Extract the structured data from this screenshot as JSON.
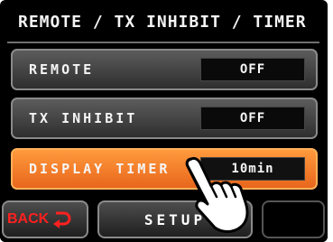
{
  "title": "REMOTE / TX INHIBIT / TIMER",
  "rows": [
    {
      "label": "REMOTE",
      "value": "OFF"
    },
    {
      "label": "TX INHIBIT",
      "value": "OFF"
    },
    {
      "label": "DISPLAY TIMER",
      "value": "10min"
    }
  ],
  "bottom": {
    "back_label": "BACK",
    "setup_label": "SETUP"
  },
  "colors": {
    "active_row": "#f07a26",
    "back_text": "#ff2020",
    "screen_bg": "#000000"
  },
  "icons": [
    "back-arrow-icon",
    "pointing-hand-icon"
  ]
}
